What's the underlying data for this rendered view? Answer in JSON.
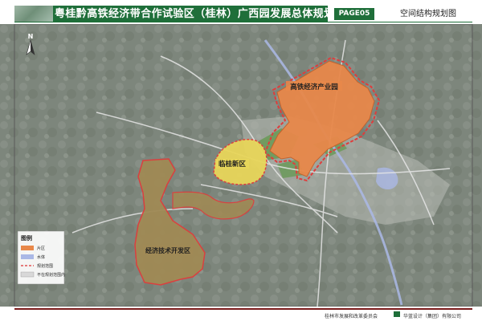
{
  "header": {
    "title": "粤桂黔高铁经济带合作试验区（桂林）广西园发展总体规划",
    "page_label": "PAGE05",
    "subtitle": "空间结构规划图"
  },
  "map": {
    "north_label": "N",
    "zones": [
      {
        "name": "高铁经济产业园",
        "color": "#e8884a"
      },
      {
        "name": "临桂新区",
        "color": "#e8d65a"
      },
      {
        "name": "经济技术开发区",
        "color": "#a08a55"
      }
    ],
    "legend": {
      "title": "图例",
      "items": [
        {
          "label": "片区",
          "color": "#e8884a"
        },
        {
          "label": "水体",
          "color": "#aab8e6"
        },
        {
          "label": "规划范围",
          "color": "#e05555"
        },
        {
          "label": "不在规划范围内",
          "color": "#d8d8d8"
        }
      ]
    },
    "colors": {
      "background": "#7d867c",
      "green_space": "#6b9a5a",
      "road": "#e6e6e6",
      "boundary": "#e03c3c"
    }
  },
  "footer": {
    "org1": "桂林市发展和改革委员会",
    "org2": "华蓝设计（集团）有限公司",
    "accent": "#7a1a1a"
  }
}
